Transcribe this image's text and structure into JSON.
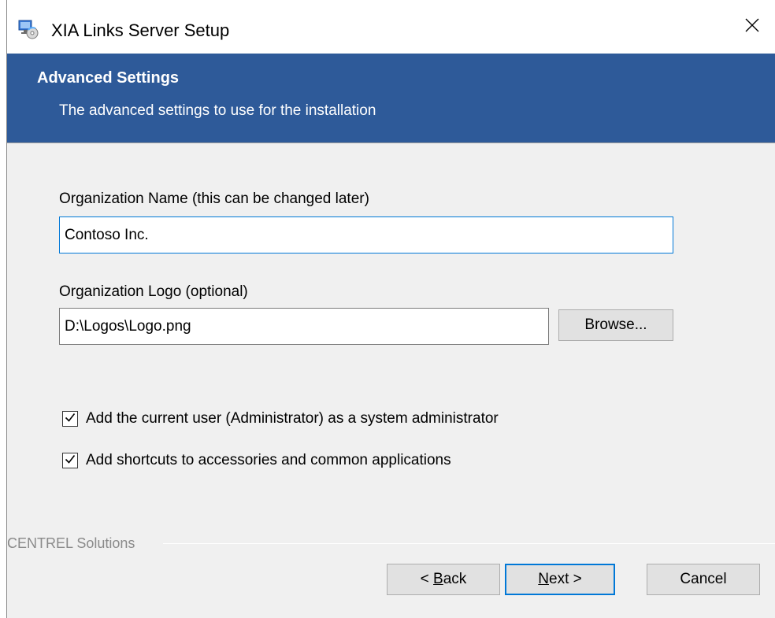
{
  "window": {
    "title": "XIA Links Server Setup",
    "app_icon": "setup-installer-icon",
    "close_icon": "close-icon"
  },
  "banner": {
    "title": "Advanced Settings",
    "subtitle": "The advanced settings to use for the installation",
    "color": "#2e5a99"
  },
  "form": {
    "org_name_label": "Organization Name (this can be changed later)",
    "org_name_value": "Contoso Inc.",
    "org_logo_label": "Organization Logo (optional)",
    "org_logo_value": "D:\\Logos\\Logo.png",
    "browse_label": "Browse...",
    "checkbox_admin_label": "Add the current user (Administrator) as a system administrator",
    "checkbox_admin_checked": true,
    "checkbox_shortcuts_label": "Add shortcuts to accessories and common applications",
    "checkbox_shortcuts_checked": true
  },
  "footer": {
    "brand": "CENTREL Solutions",
    "back_label_prefix": "< ",
    "back_label_accel": "B",
    "back_label_rest": "ack",
    "next_label_accel": "N",
    "next_label_rest": "ext >",
    "cancel_label": "Cancel"
  },
  "colors": {
    "accent": "#0078d7",
    "dialog_bg": "#f0f0f0"
  }
}
